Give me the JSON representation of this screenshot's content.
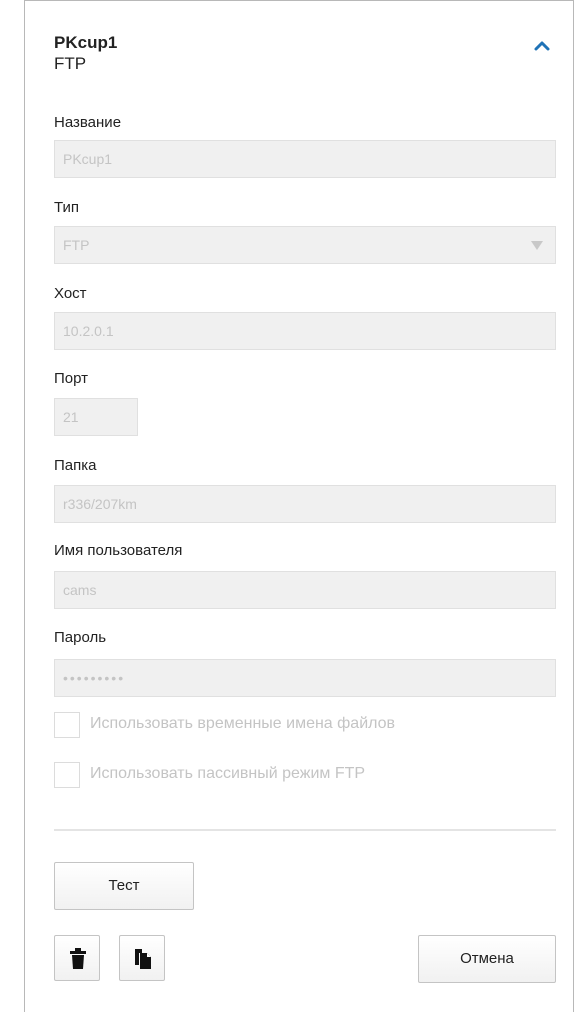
{
  "header": {
    "title": "PKcup1",
    "subtitle": "FTP",
    "collapse_icon": "chevron-up-icon"
  },
  "form": {
    "name": {
      "label": "Название",
      "value": "PKcup1"
    },
    "type": {
      "label": "Тип",
      "value": "FTP",
      "icon": "dropdown-arrow-icon"
    },
    "host": {
      "label": "Хост",
      "value": "10.2.0.1"
    },
    "port": {
      "label": "Порт",
      "value": "21"
    },
    "folder": {
      "label": "Папка",
      "value": "r336/207km"
    },
    "username": {
      "label": "Имя пользователя",
      "value": "cams"
    },
    "password": {
      "label": "Пароль",
      "value": "•••••••••"
    },
    "temp_filenames": {
      "label": "Использовать временные имена файлов",
      "checked": false
    },
    "passive_mode": {
      "label": "Использовать пассивный режим FTP",
      "checked": false
    }
  },
  "buttons": {
    "test": "Тест",
    "delete_icon": "trash-icon",
    "copy_icon": "copy-icon",
    "cancel": "Отмена"
  },
  "colors": {
    "accent": "#1f73b7",
    "disabled_text": "#c4c4c4",
    "field_bg": "#f0f0f0"
  }
}
